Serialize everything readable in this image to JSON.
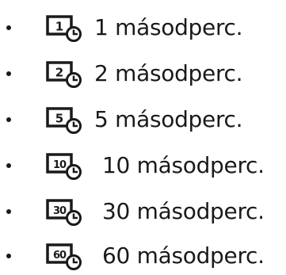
{
  "list": {
    "items": [
      {
        "number": "1",
        "label": "1 másodperc."
      },
      {
        "number": "2",
        "label": "2 másodperc."
      },
      {
        "number": "5",
        "label": "5 másodperc."
      },
      {
        "number": "10",
        "label": "10 másodperc."
      },
      {
        "number": "30",
        "label": "30 másodperc."
      },
      {
        "number": "60",
        "label": "60 másodperc."
      }
    ]
  },
  "icons": {
    "timer": "timer-icon"
  },
  "colors": {
    "text": "#1a1a1a",
    "background": "#ffffff"
  }
}
